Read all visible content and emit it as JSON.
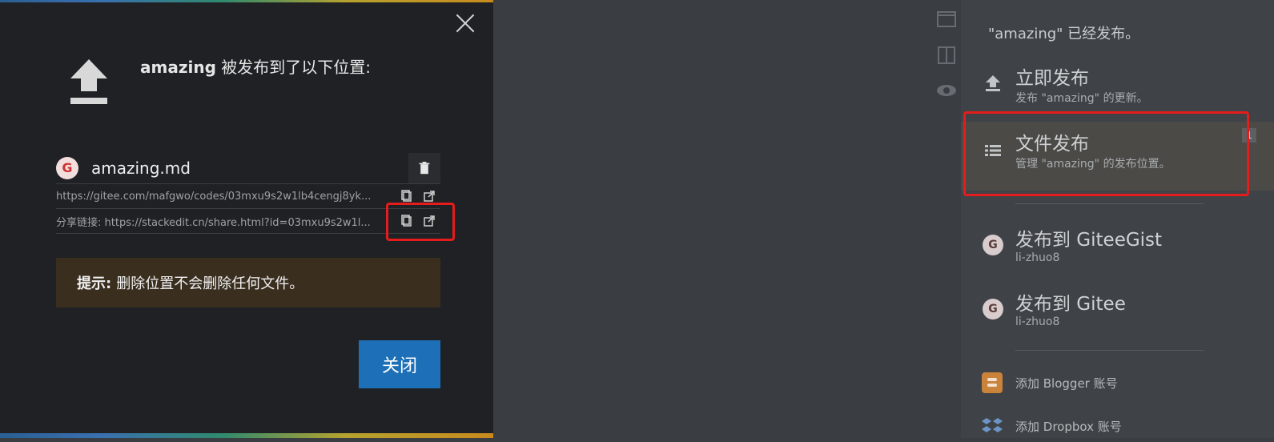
{
  "modal": {
    "title_bold": "amazing",
    "title_rest": " 被发布到了以下位置:",
    "location": {
      "file": "amazing.md",
      "url": "https://gitee.com/mafgwo/codes/03mxu9s2w1lb4cengj8yk...",
      "share": "分享链接: https://stackedit.cn/share.html?id=03mxu9s2w1l..."
    },
    "tip_label": "提示:",
    "tip_text": " 删除位置不会删除任何文件。",
    "close_label": "关闭"
  },
  "panel": {
    "header": "\"amazing\" 已经发布。",
    "items": [
      {
        "title": "立即发布",
        "sub": "发布 \"amazing\" 的更新。"
      },
      {
        "title": "文件发布",
        "sub": "管理 \"amazing\" 的发布位置。",
        "badge": "1"
      },
      {
        "title": "发布到 GiteeGist",
        "sub": "li-zhuo8"
      },
      {
        "title": "发布到 Gitee",
        "sub": "li-zhuo8"
      }
    ],
    "small_items": [
      {
        "label": "添加 Blogger 账号"
      },
      {
        "label": "添加 Dropbox 账号"
      }
    ]
  },
  "colors": {
    "accent_red": "#e51c1c",
    "primary_button": "#1d70b7"
  },
  "icons": {
    "upload": "upload-icon",
    "trash": "trash-icon",
    "copy": "copy-icon",
    "external": "external-link-icon",
    "gitee": "gitee-icon",
    "list": "list-icon",
    "blogger": "blogger-icon",
    "dropbox": "dropbox-icon",
    "close": "close-icon"
  }
}
